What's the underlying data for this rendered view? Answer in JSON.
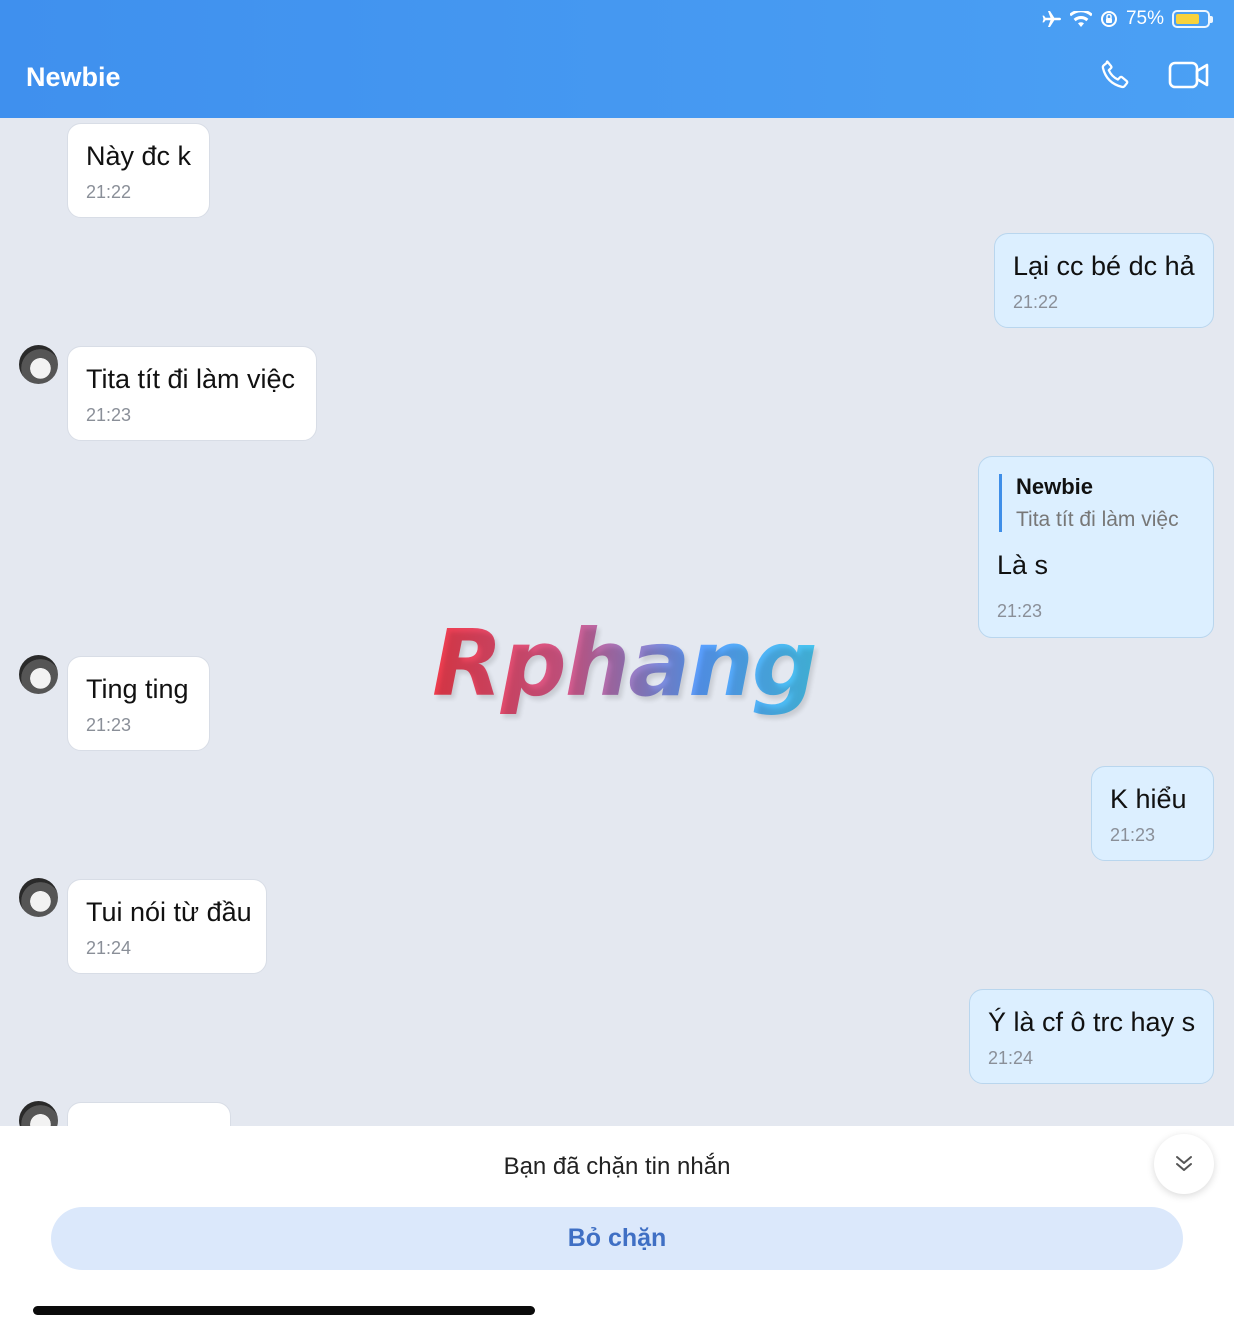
{
  "status_bar": {
    "battery_text": "75%",
    "battery_level": 0.75,
    "icons": [
      "airplane-icon",
      "wifi-icon",
      "orientation-lock-icon",
      "battery-icon"
    ]
  },
  "header": {
    "title": "Newbie",
    "call_icon": "phone-icon",
    "video_icon": "video-camera-icon"
  },
  "messages": [
    {
      "side": "in",
      "text": "Này đc k",
      "time": "21:22"
    },
    {
      "side": "out",
      "text": "Lại cc bé dc hả",
      "time": "21:22"
    },
    {
      "side": "in",
      "text": "Tita tít đi làm việc",
      "time": "21:23"
    },
    {
      "side": "out",
      "text": "Là s",
      "time": "21:23",
      "reply_to": {
        "name": "Newbie",
        "text": "Tita tít đi làm việc"
      }
    },
    {
      "side": "in",
      "text": "Ting ting",
      "time": "21:23"
    },
    {
      "side": "out",
      "text": "K hiểu",
      "time": "21:23"
    },
    {
      "side": "in",
      "text": "Tui nói từ đầu",
      "time": "21:24"
    },
    {
      "side": "out",
      "text": "Ý là cf ô trc hay s",
      "time": "21:24"
    }
  ],
  "watermark": "Rphang",
  "footer": {
    "blocked_text": "Bạn đã chặn tin nhắn",
    "unblock_label": "Bỏ chặn",
    "scroll_icon": "double-chevron-down-icon"
  },
  "colors": {
    "header": "#4298f0",
    "outgoing_bubble": "#dcefff",
    "incoming_bubble": "#ffffff",
    "unblock_button": "#dbe8fb",
    "unblock_text": "#3f6fc4"
  }
}
